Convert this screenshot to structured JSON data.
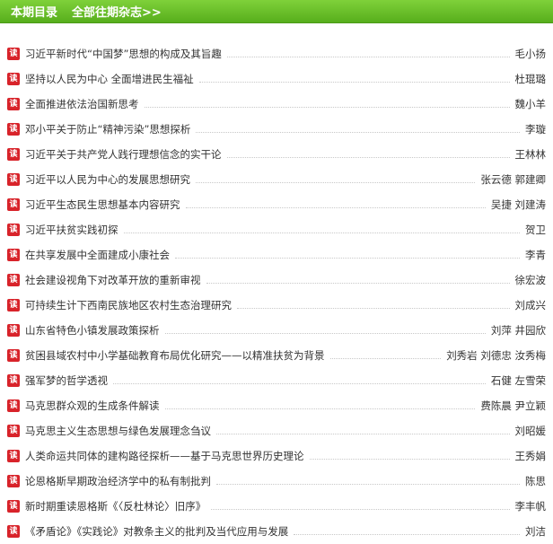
{
  "header": {
    "title": "本期目录",
    "all_link": "全部往期杂志>>",
    "accent_color": "#62b826"
  },
  "badge": {
    "label": "读",
    "color": "#d8232a",
    "icon": "read-icon"
  },
  "articles": [
    {
      "title": "习近平新时代“中国梦”思想的构成及其旨趣",
      "author": "毛小扬"
    },
    {
      "title": "坚持以人民为中心 全面增进民生福祉",
      "author": "杜琨璐"
    },
    {
      "title": "全面推进依法治国新思考",
      "author": "魏小羊"
    },
    {
      "title": "邓小平关于防止“精神污染”思想探析",
      "author": "李璇"
    },
    {
      "title": "习近平关于共产党人践行理想信念的实干论",
      "author": "王林林"
    },
    {
      "title": "习近平以人民为中心的发展思想研究",
      "author": "张云德 郭建卿"
    },
    {
      "title": "习近平生态民生思想基本内容研究",
      "author": "吴捷 刘建涛"
    },
    {
      "title": "习近平扶贫实践初探",
      "author": "贺卫"
    },
    {
      "title": "在共享发展中全面建成小康社会",
      "author": "李青"
    },
    {
      "title": "社会建设视角下对改革开放的重新审视",
      "author": "徐宏波"
    },
    {
      "title": "可持续生计下西南民族地区农村生态治理研究",
      "author": "刘成兴"
    },
    {
      "title": "山东省特色小镇发展政策探析",
      "author": "刘萍 井园欣"
    },
    {
      "title": "贫困县域农村中小学基础教育布局优化研究——以精准扶贫为背景",
      "author": "刘秀岩 刘德忠 汝秀梅"
    },
    {
      "title": "强军梦的哲学透视",
      "author": "石健 左雪荣"
    },
    {
      "title": "马克思群众观的生成条件解读",
      "author": "费陈晨 尹立颖"
    },
    {
      "title": "马克思主义生态思想与绿色发展理念刍议",
      "author": "刘昭媛"
    },
    {
      "title": "人类命运共同体的建构路径探析——基于马克思世界历史理论",
      "author": "王秀娟"
    },
    {
      "title": "论恩格斯早期政治经济学中的私有制批判",
      "author": "陈思"
    },
    {
      "title": "新时期重读恩格斯《〈反杜林论〉旧序》",
      "author": "李丰帆"
    },
    {
      "title": "《矛盾论》《实践论》对教条主义的批判及当代应用与发展",
      "author": "刘洁"
    }
  ]
}
